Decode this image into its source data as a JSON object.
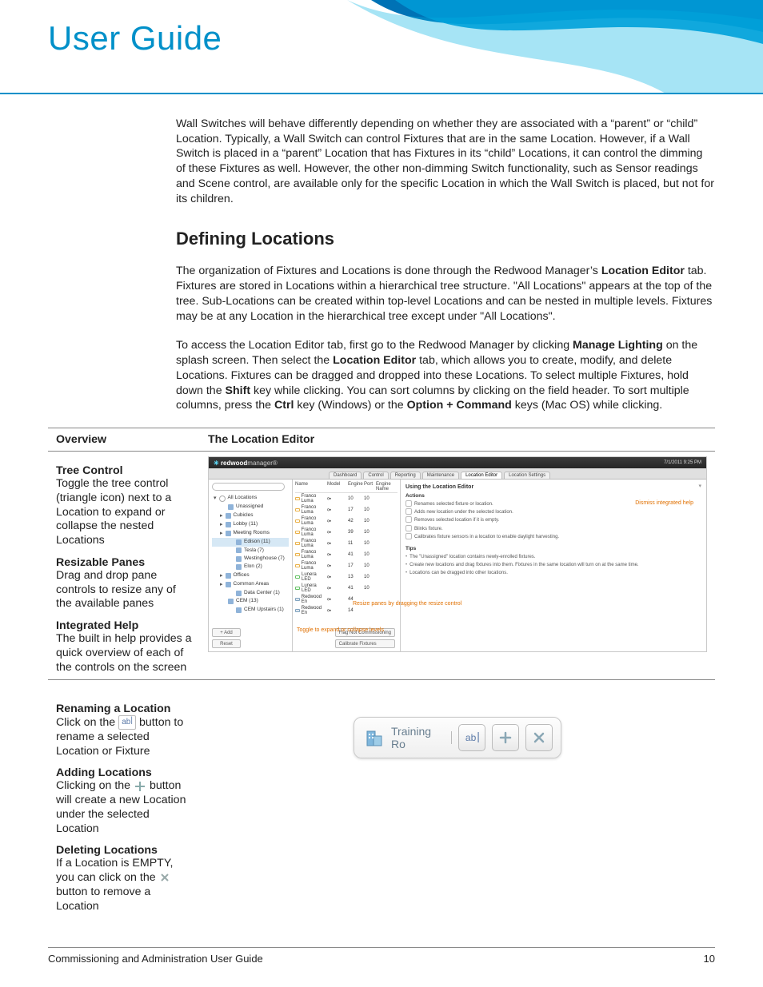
{
  "header": {
    "title": "User Guide"
  },
  "intro": "Wall Switches will behave differently depending on whether they are associated with a “parent” or “child” Location. Typically, a Wall Switch can control Fixtures that are in the same Location. However, if a Wall Switch is placed in a “parent” Location that has Fixtures in its “child” Locations, it can control the dimming of these Fixtures as well. However, the other non-dimming Switch functionality, such as Sensor readings and Scene control, are available only for the specific Location in which the Wall Switch is placed, but not for its children.",
  "heading": "Defining Locations",
  "para1_part1": "The organization of Fixtures and Locations is done through the Redwood Manager’s ",
  "para1_bold1": "Location Editor",
  "para1_part2": " tab. Fixtures are stored in Locations within a hierarchical tree structure. \"All Locations\" appears at the top of the tree. Sub-Locations can be created within top-level Locations and can be nested in multiple levels. Fixtures may be at any Location in the hierarchical tree except under \"All Locations\".",
  "para2_a": "To access the Location Editor tab, first go to the Redwood Manager by clicking ",
  "para2_b": "Manage Lighting",
  "para2_c": " on the splash screen. Then select the ",
  "para2_d": "Location Editor",
  "para2_e": " tab, which allows you to create, modify, and delete Locations. Fixtures can be dragged and dropped into these Locations. To select multiple Fixtures, hold down the ",
  "para2_f": "Shift",
  "para2_g": " key while clicking. You can sort columns by clicking on the field header. To sort multiple columns, press the ",
  "para2_h": "Ctrl",
  "para2_i": " key (Windows) or the ",
  "para2_j": "Option + Command",
  "para2_k": " keys (Mac OS) while clicking.",
  "table": {
    "colA": "Overview",
    "colB": "The Location Editor",
    "tree_title": "Tree Control",
    "tree_body": "Toggle the tree control (triangle icon) next to a Location to expand or collapse the nested Locations",
    "resize_title": "Resizable Panes",
    "resize_body": "Drag and drop pane controls to resize any of the available panes",
    "help_title": "Integrated Help",
    "help_body": "The built in help provides a quick overview of each of the controls on the screen",
    "rename_title": "Renaming a Location",
    "rename_a": "Click on the ",
    "rename_b": " button to rename a selected Location or Fixture",
    "add_title": "Adding Locations",
    "add_a": "Clicking on the ",
    "add_b": " button will create a new Location under the selected Location",
    "del_title": "Deleting Locations",
    "del_a": "If a Location is EMPTY, you can click on the ",
    "del_b": " button to remove a Location"
  },
  "app": {
    "brand1": "redwood",
    "brand2": "manager",
    "date": "7/1/2011 9:25 PM",
    "tabs": [
      "Dashboard",
      "Control",
      "Reporting",
      "Maintenance",
      "Location Editor",
      "Location Settings"
    ],
    "active_tab": 4,
    "tree": {
      "root": "All Locations",
      "nodes": [
        {
          "l": 1,
          "t": "Unassigned"
        },
        {
          "l": 1,
          "t": "Cubicles",
          "exp": true
        },
        {
          "l": 1,
          "t": "Lobby (11)",
          "exp": true
        },
        {
          "l": 1,
          "t": "Meeting Rooms",
          "exp": true
        },
        {
          "l": 2,
          "t": "Edison (11)",
          "sel": true
        },
        {
          "l": 2,
          "t": "Tesla (7)"
        },
        {
          "l": 2,
          "t": "Westinghouse (7)"
        },
        {
          "l": 2,
          "t": "Elon (2)"
        },
        {
          "l": 1,
          "t": "Offices",
          "exp": true
        },
        {
          "l": 1,
          "t": "Common Areas",
          "exp": true
        },
        {
          "l": 2,
          "t": "Data Center (1)"
        },
        {
          "l": 1,
          "t": "CEM (13)"
        },
        {
          "l": 2,
          "t": "CEM Upstairs (1)"
        }
      ],
      "btn_add": "+ Add",
      "btn_reset": "Reset"
    },
    "grid": {
      "headers": [
        "Name",
        "Model",
        "Engine",
        "Port",
        "Engine Name"
      ],
      "rows": [
        {
          "n": "Franco Luma",
          "m": "fl",
          "e": "10",
          "p": "10",
          "k": 0
        },
        {
          "n": "Franco Luma",
          "m": "fl",
          "e": "17",
          "p": "10",
          "k": 0
        },
        {
          "n": "Franco Luma",
          "m": "fl",
          "e": "42",
          "p": "10",
          "k": 0
        },
        {
          "n": "Franco Luma",
          "m": "fl",
          "e": "39",
          "p": "10",
          "k": 0
        },
        {
          "n": "Franco Luma",
          "m": "fl",
          "e": "11",
          "p": "10",
          "k": 0
        },
        {
          "n": "Franco Luma",
          "m": "fl",
          "e": "41",
          "p": "10",
          "k": 0
        },
        {
          "n": "Franco Luma",
          "m": "fl",
          "e": "17",
          "p": "10",
          "k": 0
        },
        {
          "n": "Lunera LED",
          "m": "ll",
          "e": "13",
          "p": "10",
          "k": 1
        },
        {
          "n": "Lunera LED",
          "m": "ll",
          "e": "41",
          "p": "10",
          "k": 1
        },
        {
          "n": "Redwood En",
          "m": "re",
          "e": "44",
          "p": "",
          "k": 2
        },
        {
          "n": "Redwood En",
          "m": "re",
          "e": "14",
          "p": "",
          "k": 2
        }
      ],
      "btn1": "Flag Not Commissioning",
      "btn2": "Calibrate Fixtures"
    },
    "help": {
      "title": "Using the Location Editor",
      "dismiss": "Dismiss integrated help",
      "actions_label": "Actions",
      "actions": [
        "Renames selected fixture or location.",
        "Adds new location under the selected location.",
        "Removes selected location if it is empty.",
        "Blinks fixture.",
        "Calibrates fixture sensors in a location to enable daylight harvesting."
      ],
      "tips_label": "Tips",
      "tips": [
        "The \"Unassigned\" location contains newly-enrolled fixtures.",
        "Create new locations and drag fixtures into them. Fixtures in the same location will turn on at the same time.",
        "Locations can be dragged into other locations."
      ]
    },
    "callouts": {
      "resize": "Resize panes by dragging the resize control",
      "toggle": "Toggle to expand or collapse levels",
      "dismiss": "Dismiss integrated help"
    },
    "bigbar": {
      "label": "Training Ro",
      "rename": "ab"
    }
  },
  "footer": {
    "left": "Commissioning and Administration User Guide",
    "right": "10"
  }
}
